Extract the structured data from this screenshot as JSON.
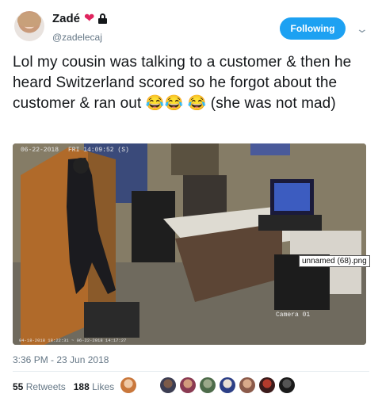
{
  "user": {
    "display_name": "Zadé",
    "heart": "❤",
    "handle": "@zadelecaj",
    "follow_label": "Following"
  },
  "tweet": {
    "text_line": "Lol my cousin was talking to a customer & then he heard Switzerland scored so he forgot about the customer & ran out",
    "emoji_a": "😂😂",
    "emoji_b": "😂",
    "text_tail": "(she was not mad)"
  },
  "media": {
    "overlay_date": "06-22-2018",
    "overlay_time": "FRI 14:09:52 (S)",
    "camera_label": "Camera 01",
    "bottom_stamp": "04-18-2018 18:22:31 ~ 06-22-2018 14:17:27",
    "file_label": "unnamed (68).png"
  },
  "meta": {
    "timestamp": "3:36 PM - 23 Jun 2018",
    "retweets_count": "55",
    "retweets_label": "Retweets",
    "likes_count": "188",
    "likes_label": "Likes"
  },
  "colors": {
    "accent": "#1da1f2",
    "heart": "#e0245e"
  }
}
